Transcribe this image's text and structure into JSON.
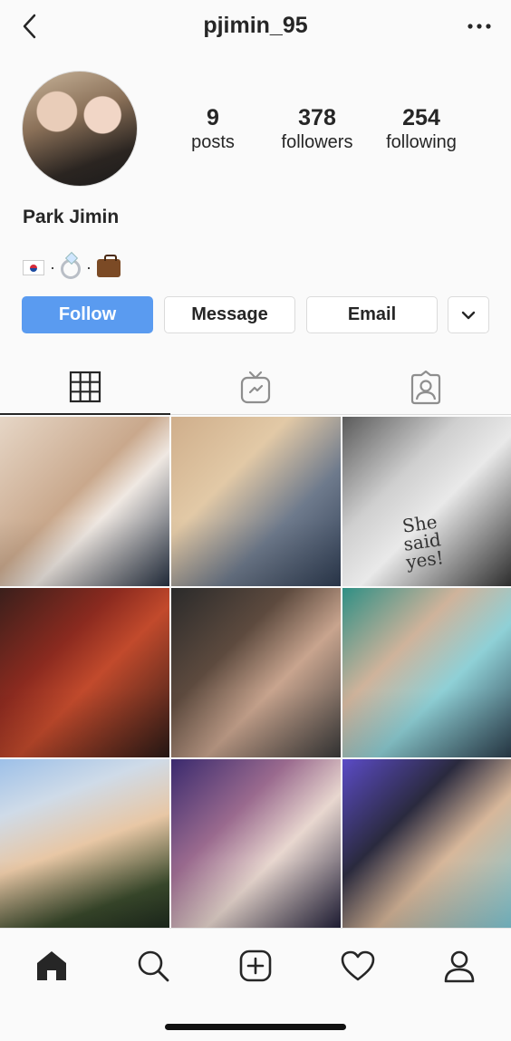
{
  "header": {
    "username": "pjimin_95",
    "back_icon": "chevron-left-icon",
    "more_icon": "ellipsis-icon"
  },
  "profile": {
    "display_name": "Park Jimin",
    "bio_items": [
      "flag-south-korea",
      "ring",
      "briefcase"
    ],
    "bio_separator": "·",
    "stats": [
      {
        "value": "9",
        "label": "posts"
      },
      {
        "value": "378",
        "label": "followers"
      },
      {
        "value": "254",
        "label": "following"
      }
    ]
  },
  "actions": {
    "follow": "Follow",
    "message": "Message",
    "email": "Email",
    "more_icon": "chevron-down-icon"
  },
  "tabs": [
    "grid-icon",
    "igtv-icon",
    "tagged-icon"
  ],
  "grid": {
    "posts": [
      {
        "id": "post-1"
      },
      {
        "id": "post-2"
      },
      {
        "id": "post-3",
        "text": "She said yes!"
      },
      {
        "id": "post-4"
      },
      {
        "id": "post-5"
      },
      {
        "id": "post-6"
      },
      {
        "id": "post-7"
      },
      {
        "id": "post-8"
      },
      {
        "id": "post-9"
      }
    ]
  },
  "bottom_nav": [
    "home-icon",
    "search-icon",
    "new-post-icon",
    "heart-icon",
    "profile-icon"
  ],
  "colors": {
    "accent": "#5a9bf0",
    "text": "#262626",
    "border": "#dbdbdb"
  }
}
